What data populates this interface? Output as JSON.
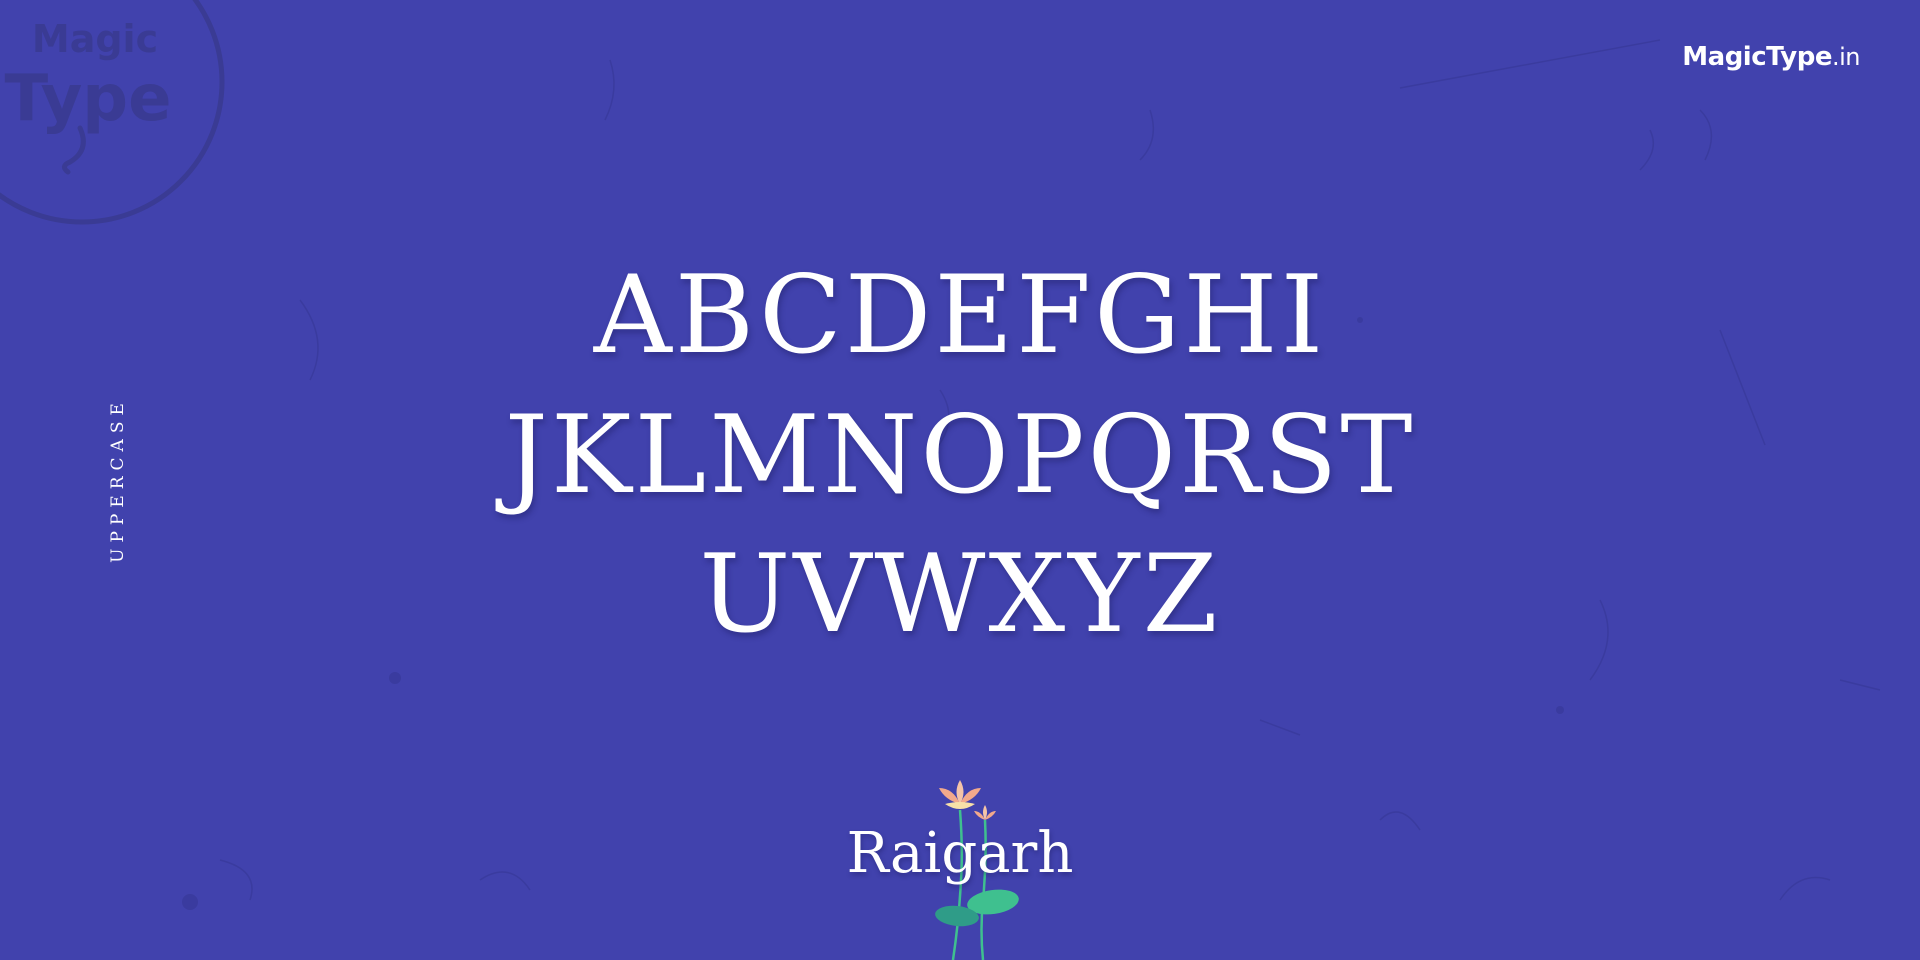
{
  "brand": {
    "name": "MagicType",
    "tld": ".in"
  },
  "watermark": {
    "line1": "Magic",
    "line2": "Type"
  },
  "side_label": "UPPERCASE",
  "alphabet": {
    "rows": [
      "ABCDEFGHI",
      "JKLMNOPQRST",
      "UVWXYZ"
    ]
  },
  "font_name": "Raigarh",
  "colors": {
    "background": "#4142ad",
    "text": "#ffffff",
    "watermark": "#3a3b94",
    "lotus_petal": "#f4c4a8",
    "lotus_leaf": "#3fc08f"
  },
  "icons": {
    "watermark": "magictype-seal-logo",
    "illustration": "lotus-icon"
  }
}
